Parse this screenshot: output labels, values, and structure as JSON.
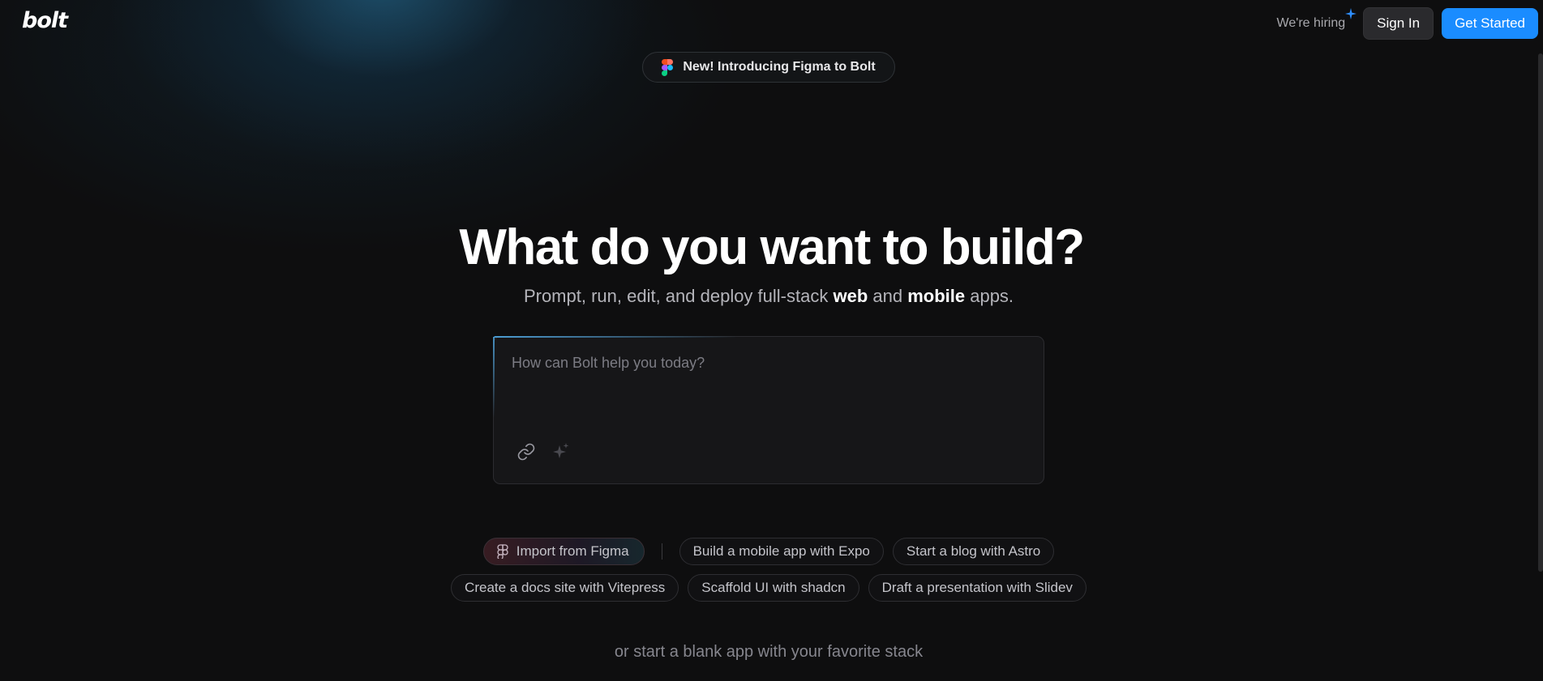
{
  "header": {
    "logo_text": "bolt",
    "hiring_label": "We're hiring",
    "signin_label": "Sign In",
    "get_started_label": "Get Started"
  },
  "announcement": {
    "label": "New! Introducing Figma to Bolt"
  },
  "hero": {
    "title": "What do you want to build?",
    "subtitle_prefix": "Prompt, run, edit, and deploy full-stack ",
    "subtitle_web": "web",
    "subtitle_and": " and ",
    "subtitle_mobile": "mobile",
    "subtitle_suffix": " apps."
  },
  "prompt": {
    "placeholder": "How can Bolt help you today?",
    "value": ""
  },
  "suggestions": {
    "import_figma": "Import from Figma",
    "row1": [
      "Build a mobile app with Expo",
      "Start a blog with Astro"
    ],
    "row2": [
      "Create a docs site with Vitepress",
      "Scaffold UI with shadcn",
      "Draft a presentation with Slidev"
    ]
  },
  "footer": {
    "blank_app": "or start a blank app with your favorite stack"
  },
  "colors": {
    "background": "#0e0e0f",
    "accent_blue": "#1a8cff",
    "signin_bg": "#2a2a2d",
    "prompt_bg": "#161618"
  },
  "icons": {
    "hiring": "sparkle-icon",
    "announcement": "figma-icon",
    "attach": "link-icon",
    "enhance": "sparkles-icon",
    "import": "figma-outline-icon"
  }
}
